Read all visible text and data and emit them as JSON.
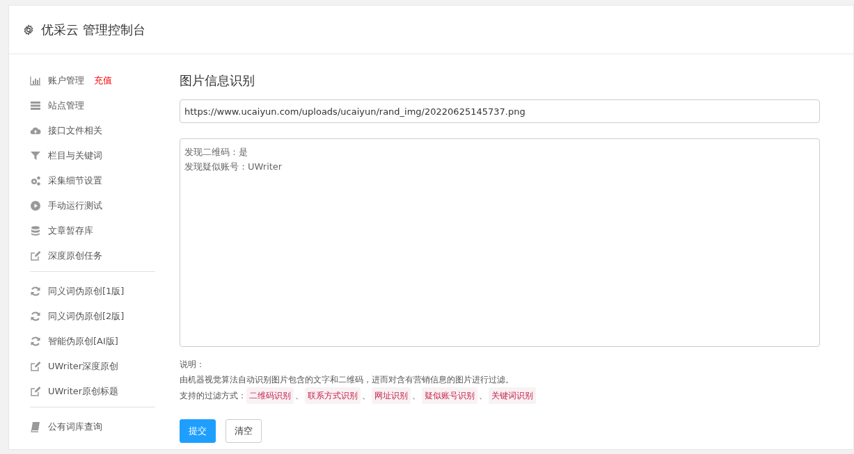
{
  "header": {
    "title": "优采云 管理控制台"
  },
  "sidebar": {
    "groups": [
      [
        {
          "label": "账户管理",
          "badge": "充值",
          "kind": "chart"
        },
        {
          "label": "站点管理",
          "kind": "server"
        },
        {
          "label": "接口文件相关",
          "kind": "cloud"
        },
        {
          "label": "栏目与关键词",
          "kind": "filter"
        },
        {
          "label": "采集细节设置",
          "kind": "gears"
        },
        {
          "label": "手动运行测试",
          "kind": "play"
        },
        {
          "label": "文章暂存库",
          "kind": "database"
        },
        {
          "label": "深度原创任务",
          "kind": "edit"
        }
      ],
      [
        {
          "label": "同义词伪原创[1版]",
          "kind": "refresh"
        },
        {
          "label": "同义词伪原创[2版]",
          "kind": "refresh"
        },
        {
          "label": "智能伪原创[AI版]",
          "kind": "refresh"
        },
        {
          "label": "UWriter深度原创",
          "kind": "edit"
        },
        {
          "label": "UWriter原创标题",
          "kind": "edit"
        }
      ],
      [
        {
          "label": "公有词库查询",
          "kind": "book"
        }
      ]
    ]
  },
  "main": {
    "title": "图片信息识别",
    "url_field": {
      "value": "https://www.ucaiyun.com/uploads/ucaiyun/rand_img/20220625145737.png"
    },
    "result_field": {
      "lines": [
        "发现二维码：是",
        "发现疑似账号：UWriter"
      ]
    },
    "notes": {
      "heading": "说明：",
      "description": "由机器视觉算法自动识别图片包含的文字和二维码，进而对含有营销信息的图片进行过滤。",
      "filters_label": "支持的过滤方式：",
      "separator": "、",
      "filters": [
        "二维码识别",
        "联系方式识别",
        "网址识别",
        "疑似账号识别",
        "关键词识别"
      ]
    },
    "buttons": [
      {
        "label": "提交",
        "kind": "primary"
      },
      {
        "label": "清空",
        "kind": "default"
      }
    ]
  }
}
